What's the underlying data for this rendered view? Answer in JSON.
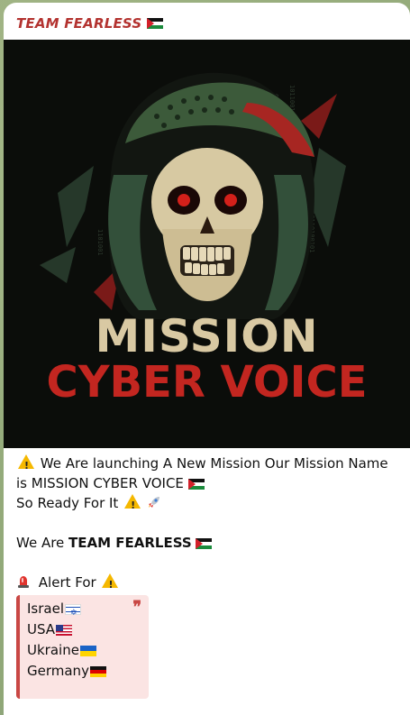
{
  "channel": {
    "name": "TEAM FEARLESS",
    "name_flag_icon": "palestine-flag-icon"
  },
  "media": {
    "type": "image",
    "icons": [
      "skull-icon"
    ],
    "title_line1": "MISSION",
    "title_line2": "CYBER VOICE",
    "colors": {
      "background": "#0b0d0a",
      "line1": "#d9c9a3",
      "line2": "#c32620",
      "keffiyeh_green": "#3c5a3a"
    }
  },
  "message": {
    "line1": "We Are launching A New Mission Our Mission Name",
    "line2": "is MISSION CYBER VOICE",
    "line3": "So Ready For It",
    "line5_prefix": "We Are ",
    "line5_bold": "TEAM FEARLESS",
    "alert_label": "Alert For",
    "icons": {
      "warning": "warning-icon",
      "rocket": "rocket-icon",
      "siren": "siren-icon",
      "flag": "palestine-flag-icon"
    }
  },
  "quote": {
    "items": [
      {
        "label": "Israel",
        "flag": "israel-flag-icon"
      },
      {
        "label": "USA",
        "flag": "usa-flag-icon"
      },
      {
        "label": "Ukraine",
        "flag": "ukraine-flag-icon"
      },
      {
        "label": "Germany",
        "flag": "germany-flag-icon"
      }
    ],
    "accent_color": "#c94744",
    "background_color": "#fbe4e3"
  }
}
